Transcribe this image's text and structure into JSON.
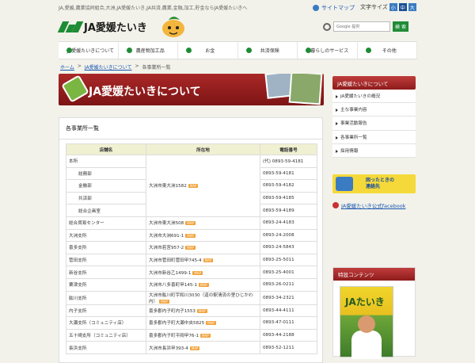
{
  "topbar": {
    "tagline": "JA,愛媛,農業協同組合,大洲,JA愛媛たいき,JA共済,農業,金融,加工,貯金ならJA愛媛たいきへ",
    "sitemap": "サイトマップ",
    "font_size_label": "文字サイズ",
    "font_sizes": [
      "小",
      "中",
      "大"
    ]
  },
  "logo": {
    "text": "JA愛媛たいき"
  },
  "search": {
    "placeholder": "Google 提供",
    "button": "検 索"
  },
  "nav": [
    "JA愛媛たいきについて",
    "農産物加工品",
    "お金",
    "共済保険",
    "暮らしのサービス",
    "その他"
  ],
  "breadcrumb": {
    "home": "ホーム",
    "sep": ">",
    "parent": "JA愛媛たいきについて",
    "current": "各事業所一覧"
  },
  "hero": {
    "title": "JA愛媛たいきについて"
  },
  "section_title": "各事業所一覧",
  "table": {
    "headers": [
      "店舗名",
      "所在地",
      "電話番号"
    ],
    "map_label": "MAP",
    "honsho": {
      "name": "本所",
      "address": "大洲市東大洲1582",
      "rows": [
        {
          "name": "",
          "phone": "(代) 0893-59-4181"
        },
        {
          "name": "総務部",
          "phone": "0893-59-4181"
        },
        {
          "name": "金融部",
          "phone": "0893-59-4182"
        },
        {
          "name": "共済部",
          "phone": "0893-59-4185"
        },
        {
          "name": "総合企画室",
          "phone": "0893-59-4189"
        }
      ]
    },
    "rows": [
      {
        "name": "総合貿易センター",
        "address": "大洲市東大洲508",
        "phone": "0893-24-4183"
      },
      {
        "name": "大洲支所",
        "address": "大洲市大洲691-1",
        "phone": "0893-24-2008"
      },
      {
        "name": "喜多支所",
        "address": "大洲市若宮957-2",
        "phone": "0893-24-5843"
      },
      {
        "name": "菅田支所",
        "address": "大洲市菅田町菅田甲745-4",
        "phone": "0893-25-5011"
      },
      {
        "name": "新谷支所",
        "address": "大洲市新谷乙1499-1",
        "phone": "0893-25-4001"
      },
      {
        "name": "粟津支所",
        "address": "大洲市八多喜町甲145-1",
        "phone": "0893-26-0211"
      },
      {
        "name": "肱川支所",
        "address": "大洲市肱川町宇和川3030（道の駅清流の里ひじかわ内）",
        "phone": "0893-34-2321"
      },
      {
        "name": "内子支所",
        "address": "喜多郡内子町内子1553",
        "phone": "0893-44-4111"
      },
      {
        "name": "大瀬支所（コミュニティ店）",
        "address": "喜多郡内子町大瀬中央5825",
        "phone": "0893-47-0111"
      },
      {
        "name": "五十崎支所（コミュニティ店）",
        "address": "喜多郡内子町平岡甲76-1",
        "phone": "0893-44-2188"
      },
      {
        "name": "長浜支所",
        "address": "大洲市長浜甲393-4",
        "phone": "0893-52-1211"
      }
    ]
  },
  "sidebar": {
    "header": "JA愛媛たいきについて",
    "items": [
      "JA愛媛たいきの概況",
      "主な事業内容",
      "事業活動報告",
      "各事業所一覧",
      "採用情報"
    ]
  },
  "emergency": {
    "line1": "困ったときの",
    "line2": "連絡先"
  },
  "facebook": "JA愛媛たいき公式facebook",
  "featured": {
    "header": "特設コンテンツ",
    "magazine": "JAたいき"
  }
}
